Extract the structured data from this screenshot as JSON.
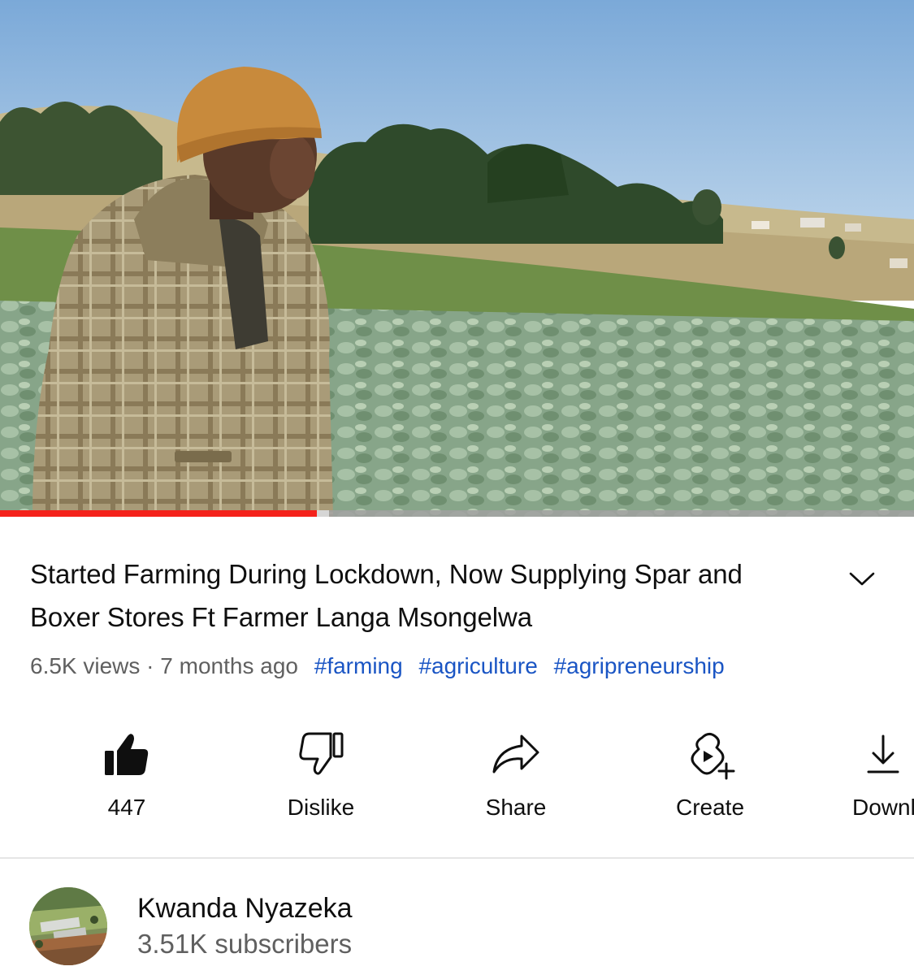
{
  "video": {
    "progress_fraction": 0.347,
    "buffered_fraction": 0.36
  },
  "title": "Started Farming During Lockdown, Now Supplying Spar and Boxer Stores Ft Farmer Langa Msongelwa",
  "meta": {
    "views": "6.5K views",
    "separator": " · ",
    "age": "7 months ago",
    "hashtags": [
      "#farming",
      "#agriculture",
      "#agripreneurship"
    ]
  },
  "actions": {
    "like": {
      "label": "447",
      "icon": "thumbs-up-filled-icon"
    },
    "dislike": {
      "label": "Dislike",
      "icon": "thumbs-down-outline-icon"
    },
    "share": {
      "label": "Share",
      "icon": "share-arrow-icon"
    },
    "create": {
      "label": "Create",
      "icon": "create-remix-icon"
    },
    "download": {
      "label": "Download",
      "icon": "download-icon"
    }
  },
  "channel": {
    "name": "Kwanda Nyazeka",
    "subscribers": "3.51K subscribers"
  },
  "colors": {
    "progress": "#f4221b",
    "hashtag": "#1a55c4",
    "muted_text": "#606060",
    "text": "#0f0f0f"
  }
}
